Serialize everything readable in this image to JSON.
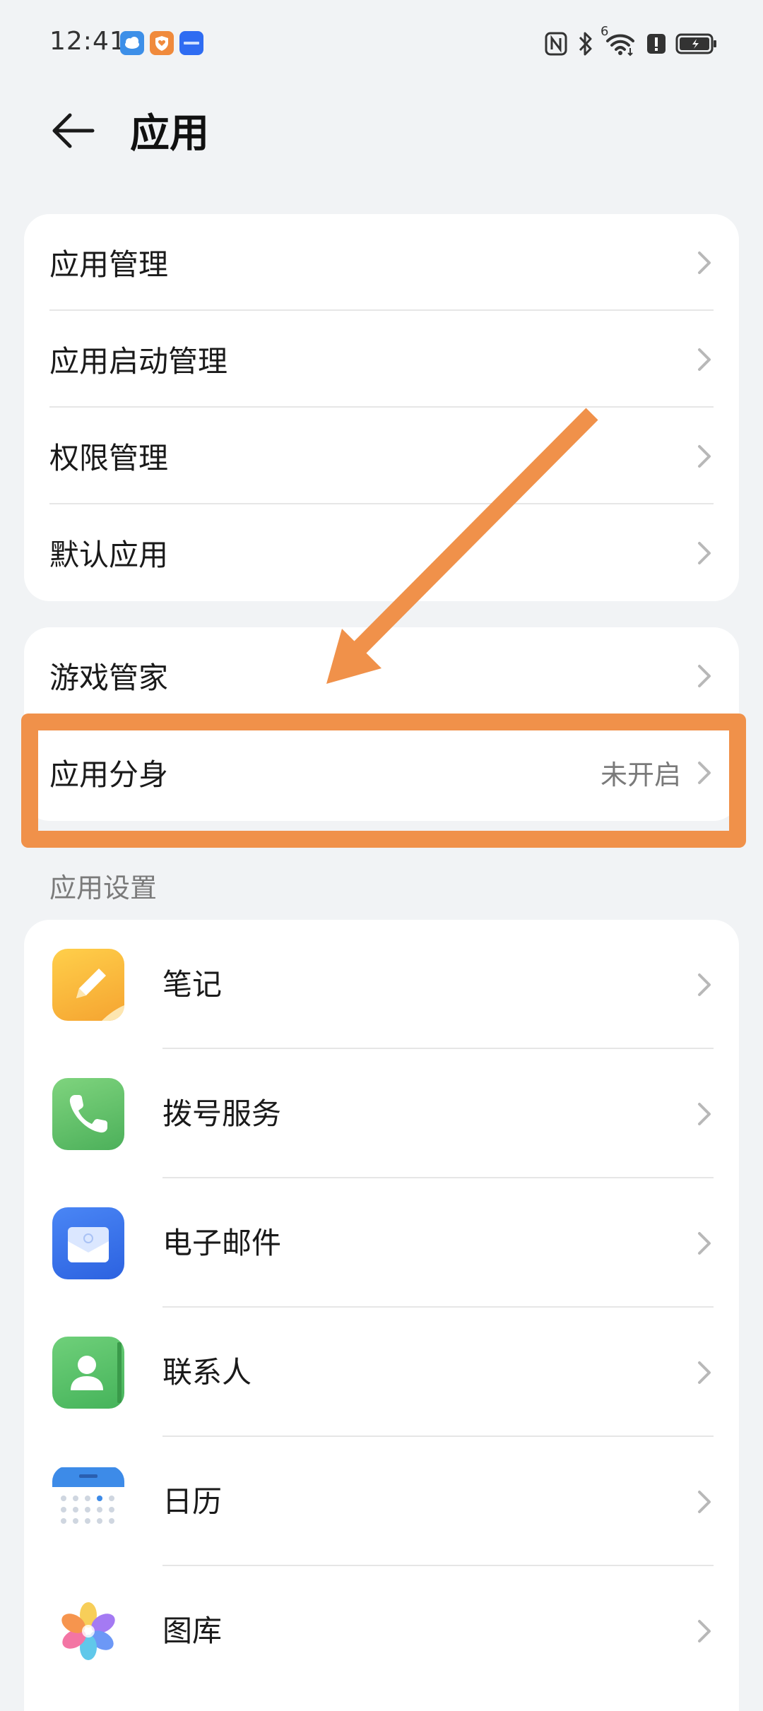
{
  "status_bar": {
    "time": "12:41",
    "network_label": "6"
  },
  "header": {
    "title": "应用"
  },
  "group1": {
    "items": [
      {
        "label": "应用管理"
      },
      {
        "label": "应用启动管理"
      },
      {
        "label": "权限管理"
      },
      {
        "label": "默认应用"
      }
    ]
  },
  "group2": {
    "items": [
      {
        "label": "游戏管家",
        "value": ""
      },
      {
        "label": "应用分身",
        "value": "未开启"
      }
    ]
  },
  "app_settings": {
    "section_title": "应用设置",
    "items": [
      {
        "label": "笔记",
        "icon": "notes-icon"
      },
      {
        "label": "拨号服务",
        "icon": "phone-icon"
      },
      {
        "label": "电子邮件",
        "icon": "email-icon"
      },
      {
        "label": "联系人",
        "icon": "contacts-icon"
      },
      {
        "label": "日历",
        "icon": "calendar-icon"
      },
      {
        "label": "图库",
        "icon": "gallery-icon"
      }
    ]
  },
  "colors": {
    "background": "#f1f3f5",
    "card": "#ffffff",
    "annotation": "#f0914a",
    "secondary_text": "#7a7a7a"
  }
}
